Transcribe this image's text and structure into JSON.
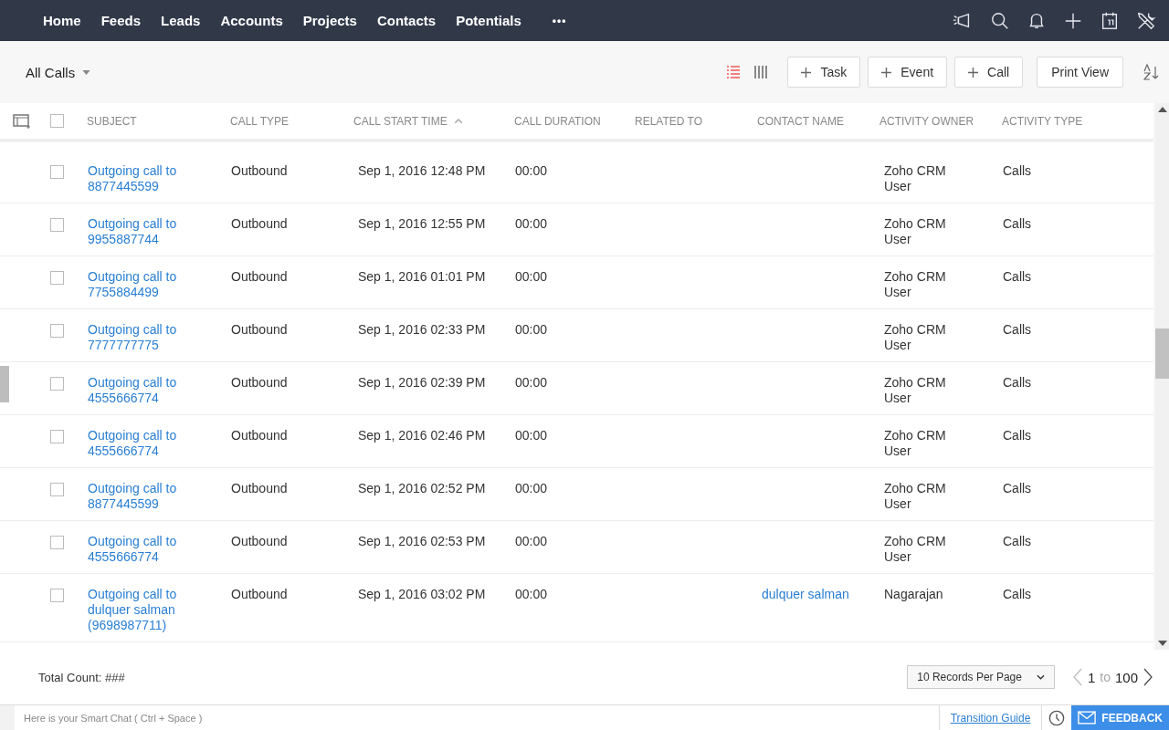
{
  "nav": {
    "items": [
      "Home",
      "Feeds",
      "Leads",
      "Accounts",
      "Projects",
      "Contacts",
      "Potentials"
    ],
    "more": "•••"
  },
  "toolbar": {
    "view": "All Calls",
    "view_modes": [
      {
        "kind": "list",
        "selected": true
      },
      {
        "kind": "columns",
        "selected": false
      }
    ],
    "buttons": [
      "Task",
      "Event",
      "Call"
    ],
    "print": "Print View"
  },
  "table": {
    "select_all": {
      "checked": false
    },
    "columns": [
      {
        "label": "SUBJECT",
        "sorted": false
      },
      {
        "label": "CALL TYPE",
        "sorted": false
      },
      {
        "label": "CALL START TIME",
        "sorted": true
      },
      {
        "label": "CALL DURATION",
        "sorted": false
      },
      {
        "label": "RELATED TO",
        "sorted": false
      },
      {
        "label": "CONTACT NAME",
        "sorted": false
      },
      {
        "label": "ACTIVITY OWNER",
        "sorted": false
      },
      {
        "label": "ACTIVITY TYPE",
        "sorted": false
      }
    ],
    "rows": [
      {
        "selected": false,
        "subject": "Outgoing call to 8877445599",
        "call_type": "Outbound",
        "start": "Sep 1, 2016 12:48 PM",
        "duration": "00:00",
        "owner": "Zoho CRM User",
        "activity_type": "Calls"
      },
      {
        "selected": false,
        "subject": "Outgoing call to 9955887744",
        "call_type": "Outbound",
        "start": "Sep 1, 2016 12:55 PM",
        "duration": "00:00",
        "owner": "Zoho CRM User",
        "activity_type": "Calls"
      },
      {
        "selected": false,
        "subject": "Outgoing call to 7755884499",
        "call_type": "Outbound",
        "start": "Sep 1, 2016 01:01 PM",
        "duration": "00:00",
        "owner": "Zoho CRM User",
        "activity_type": "Calls"
      },
      {
        "selected": false,
        "subject": "Outgoing call to 7777777775",
        "call_type": "Outbound",
        "start": "Sep 1, 2016 02:33 PM",
        "duration": "00:00",
        "owner": "Zoho CRM User",
        "activity_type": "Calls"
      },
      {
        "selected": false,
        "subject": "Outgoing call to 4555666774",
        "call_type": "Outbound",
        "start": "Sep 1, 2016 02:39 PM",
        "duration": "00:00",
        "owner": "Zoho CRM User",
        "activity_type": "Calls"
      },
      {
        "selected": false,
        "subject": "Outgoing call to 4555666774",
        "call_type": "Outbound",
        "start": "Sep 1, 2016 02:46 PM",
        "duration": "00:00",
        "owner": "Zoho CRM User",
        "activity_type": "Calls"
      },
      {
        "selected": false,
        "subject": "Outgoing call to 8877445599",
        "call_type": "Outbound",
        "start": "Sep 1, 2016 02:52 PM",
        "duration": "00:00",
        "owner": "Zoho CRM User",
        "activity_type": "Calls"
      },
      {
        "selected": false,
        "subject": "Outgoing call to 4555666774",
        "call_type": "Outbound",
        "start": "Sep 1, 2016 02:53 PM",
        "duration": "00:00",
        "owner": "Zoho CRM User",
        "activity_type": "Calls"
      },
      {
        "selected": false,
        "subject": "Outgoing call to dulquer salman (9698987711)",
        "call_type": "Outbound",
        "start": "Sep 1, 2016 03:02 PM",
        "duration": "00:00",
        "contact": "dulquer salman",
        "owner": "Nagarajan",
        "activity_type": "Calls"
      }
    ]
  },
  "footer": {
    "total": "Total Count: ###",
    "per_page": "10 Records Per Page",
    "page_from": "1",
    "page_to_word": "to",
    "page_to": "100"
  },
  "bottom_bar": {
    "chat_placeholder": "Here is your Smart Chat ( Ctrl + Space )",
    "guide": "Transition Guide",
    "feedback": "FEEDBACK"
  }
}
